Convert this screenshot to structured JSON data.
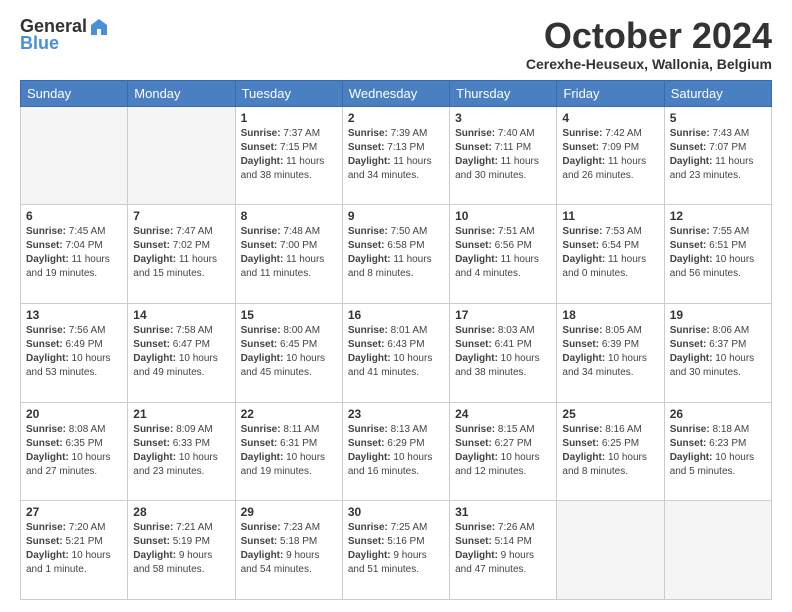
{
  "header": {
    "logo_general": "General",
    "logo_blue": "Blue",
    "month_title": "October 2024",
    "subtitle": "Cerexhe-Heuseux, Wallonia, Belgium"
  },
  "weekdays": [
    "Sunday",
    "Monday",
    "Tuesday",
    "Wednesday",
    "Thursday",
    "Friday",
    "Saturday"
  ],
  "weeks": [
    [
      {
        "day": "",
        "empty": true
      },
      {
        "day": "",
        "empty": true
      },
      {
        "day": "1",
        "sunrise": "7:37 AM",
        "sunset": "7:15 PM",
        "daylight": "11 hours and 38 minutes."
      },
      {
        "day": "2",
        "sunrise": "7:39 AM",
        "sunset": "7:13 PM",
        "daylight": "11 hours and 34 minutes."
      },
      {
        "day": "3",
        "sunrise": "7:40 AM",
        "sunset": "7:11 PM",
        "daylight": "11 hours and 30 minutes."
      },
      {
        "day": "4",
        "sunrise": "7:42 AM",
        "sunset": "7:09 PM",
        "daylight": "11 hours and 26 minutes."
      },
      {
        "day": "5",
        "sunrise": "7:43 AM",
        "sunset": "7:07 PM",
        "daylight": "11 hours and 23 minutes."
      }
    ],
    [
      {
        "day": "6",
        "sunrise": "7:45 AM",
        "sunset": "7:04 PM",
        "daylight": "11 hours and 19 minutes."
      },
      {
        "day": "7",
        "sunrise": "7:47 AM",
        "sunset": "7:02 PM",
        "daylight": "11 hours and 15 minutes."
      },
      {
        "day": "8",
        "sunrise": "7:48 AM",
        "sunset": "7:00 PM",
        "daylight": "11 hours and 11 minutes."
      },
      {
        "day": "9",
        "sunrise": "7:50 AM",
        "sunset": "6:58 PM",
        "daylight": "11 hours and 8 minutes."
      },
      {
        "day": "10",
        "sunrise": "7:51 AM",
        "sunset": "6:56 PM",
        "daylight": "11 hours and 4 minutes."
      },
      {
        "day": "11",
        "sunrise": "7:53 AM",
        "sunset": "6:54 PM",
        "daylight": "11 hours and 0 minutes."
      },
      {
        "day": "12",
        "sunrise": "7:55 AM",
        "sunset": "6:51 PM",
        "daylight": "10 hours and 56 minutes."
      }
    ],
    [
      {
        "day": "13",
        "sunrise": "7:56 AM",
        "sunset": "6:49 PM",
        "daylight": "10 hours and 53 minutes."
      },
      {
        "day": "14",
        "sunrise": "7:58 AM",
        "sunset": "6:47 PM",
        "daylight": "10 hours and 49 minutes."
      },
      {
        "day": "15",
        "sunrise": "8:00 AM",
        "sunset": "6:45 PM",
        "daylight": "10 hours and 45 minutes."
      },
      {
        "day": "16",
        "sunrise": "8:01 AM",
        "sunset": "6:43 PM",
        "daylight": "10 hours and 41 minutes."
      },
      {
        "day": "17",
        "sunrise": "8:03 AM",
        "sunset": "6:41 PM",
        "daylight": "10 hours and 38 minutes."
      },
      {
        "day": "18",
        "sunrise": "8:05 AM",
        "sunset": "6:39 PM",
        "daylight": "10 hours and 34 minutes."
      },
      {
        "day": "19",
        "sunrise": "8:06 AM",
        "sunset": "6:37 PM",
        "daylight": "10 hours and 30 minutes."
      }
    ],
    [
      {
        "day": "20",
        "sunrise": "8:08 AM",
        "sunset": "6:35 PM",
        "daylight": "10 hours and 27 minutes."
      },
      {
        "day": "21",
        "sunrise": "8:09 AM",
        "sunset": "6:33 PM",
        "daylight": "10 hours and 23 minutes."
      },
      {
        "day": "22",
        "sunrise": "8:11 AM",
        "sunset": "6:31 PM",
        "daylight": "10 hours and 19 minutes."
      },
      {
        "day": "23",
        "sunrise": "8:13 AM",
        "sunset": "6:29 PM",
        "daylight": "10 hours and 16 minutes."
      },
      {
        "day": "24",
        "sunrise": "8:15 AM",
        "sunset": "6:27 PM",
        "daylight": "10 hours and 12 minutes."
      },
      {
        "day": "25",
        "sunrise": "8:16 AM",
        "sunset": "6:25 PM",
        "daylight": "10 hours and 8 minutes."
      },
      {
        "day": "26",
        "sunrise": "8:18 AM",
        "sunset": "6:23 PM",
        "daylight": "10 hours and 5 minutes."
      }
    ],
    [
      {
        "day": "27",
        "sunrise": "7:20 AM",
        "sunset": "5:21 PM",
        "daylight": "10 hours and 1 minute."
      },
      {
        "day": "28",
        "sunrise": "7:21 AM",
        "sunset": "5:19 PM",
        "daylight": "9 hours and 58 minutes."
      },
      {
        "day": "29",
        "sunrise": "7:23 AM",
        "sunset": "5:18 PM",
        "daylight": "9 hours and 54 minutes."
      },
      {
        "day": "30",
        "sunrise": "7:25 AM",
        "sunset": "5:16 PM",
        "daylight": "9 hours and 51 minutes."
      },
      {
        "day": "31",
        "sunrise": "7:26 AM",
        "sunset": "5:14 PM",
        "daylight": "9 hours and 47 minutes."
      },
      {
        "day": "",
        "empty": true
      },
      {
        "day": "",
        "empty": true
      }
    ]
  ],
  "labels": {
    "sunrise": "Sunrise:",
    "sunset": "Sunset:",
    "daylight": "Daylight:"
  }
}
